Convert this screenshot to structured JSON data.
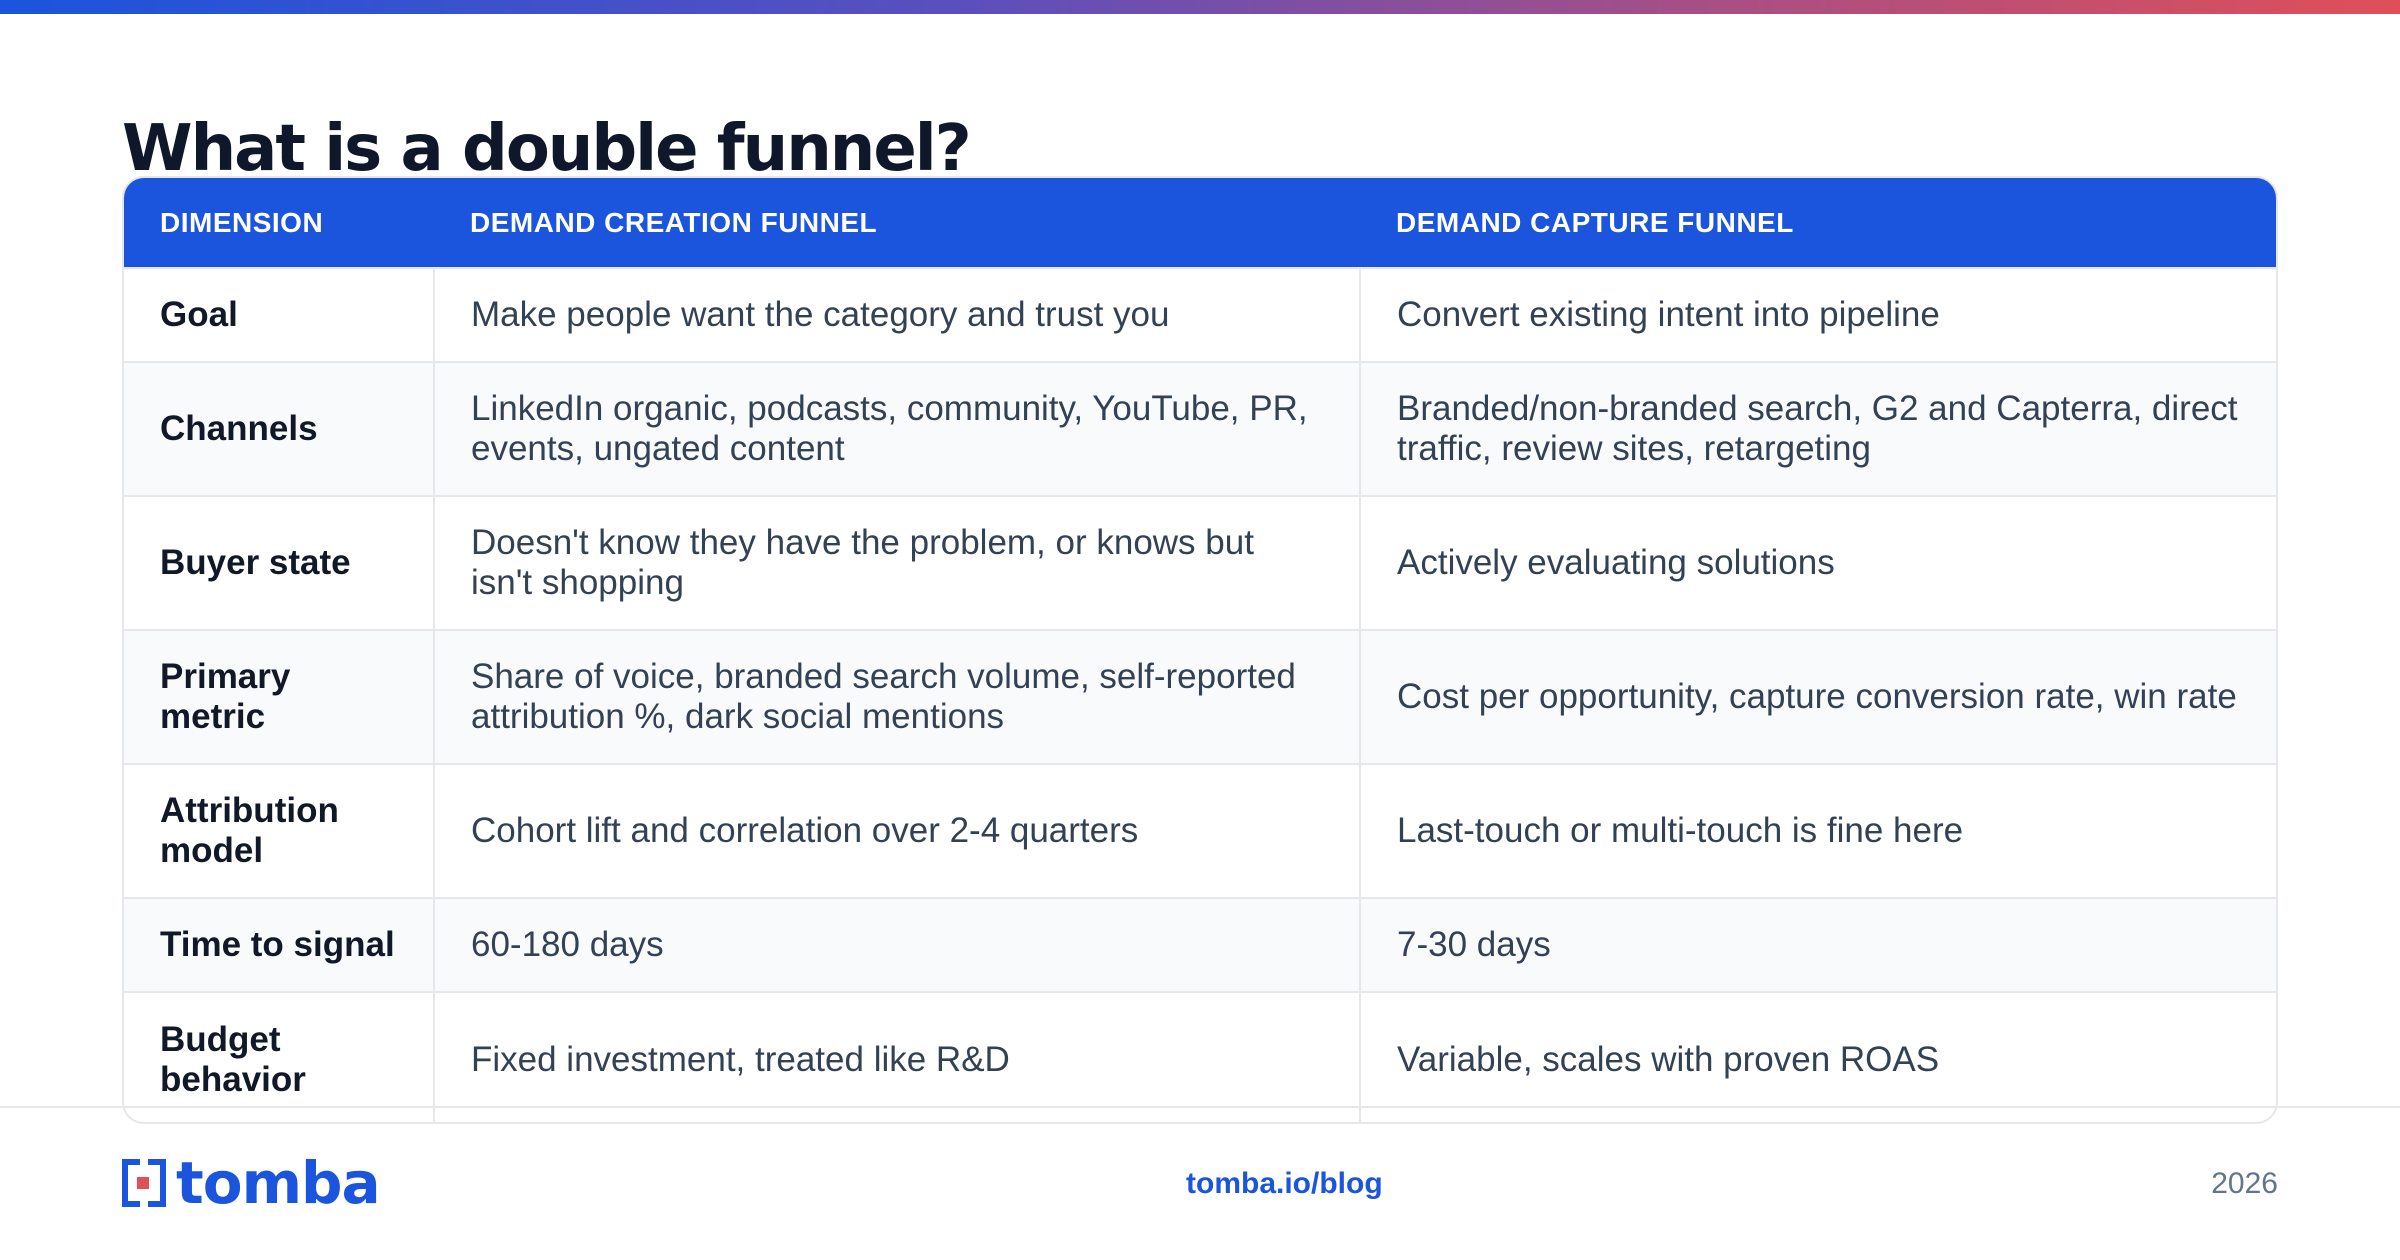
{
  "title": "What is a double funnel?",
  "table": {
    "headers": [
      "DIMENSION",
      "DEMAND CREATION FUNNEL",
      "DEMAND CAPTURE FUNNEL"
    ],
    "rows": [
      [
        "Goal",
        "Make people want the category and trust you",
        "Convert existing intent into pipeline"
      ],
      [
        "Channels",
        "LinkedIn organic, podcasts, community, YouTube, PR, events, ungated content",
        "Branded/non-branded search, G2 and Capterra, direct traffic, review sites, retargeting"
      ],
      [
        "Buyer state",
        "Doesn't know they have the problem, or knows but isn't shopping",
        "Actively evaluating solutions"
      ],
      [
        "Primary metric",
        "Share of voice, branded search volume, self-reported attribution %, dark social mentions",
        "Cost per opportunity, capture conversion rate, win rate"
      ],
      [
        "Attribution model",
        "Cohort lift and correlation over 2-4 quarters",
        "Last-touch or multi-touch is fine here"
      ],
      [
        "Time to signal",
        "60-180 days",
        "7-30 days"
      ],
      [
        "Budget behavior",
        "Fixed investment, treated like R&D",
        "Variable, scales with proven ROAS"
      ]
    ]
  },
  "footer": {
    "brand": "tomba",
    "url": "tomba.io/blog",
    "year": "2026"
  },
  "colors": {
    "accent": "#1b54dd",
    "title": "#0f172a",
    "body_text": "#334155",
    "gradient": [
      "#1b54dd",
      "#e04f58"
    ]
  },
  "icons": {
    "logo": "tomba-logo-mark"
  }
}
